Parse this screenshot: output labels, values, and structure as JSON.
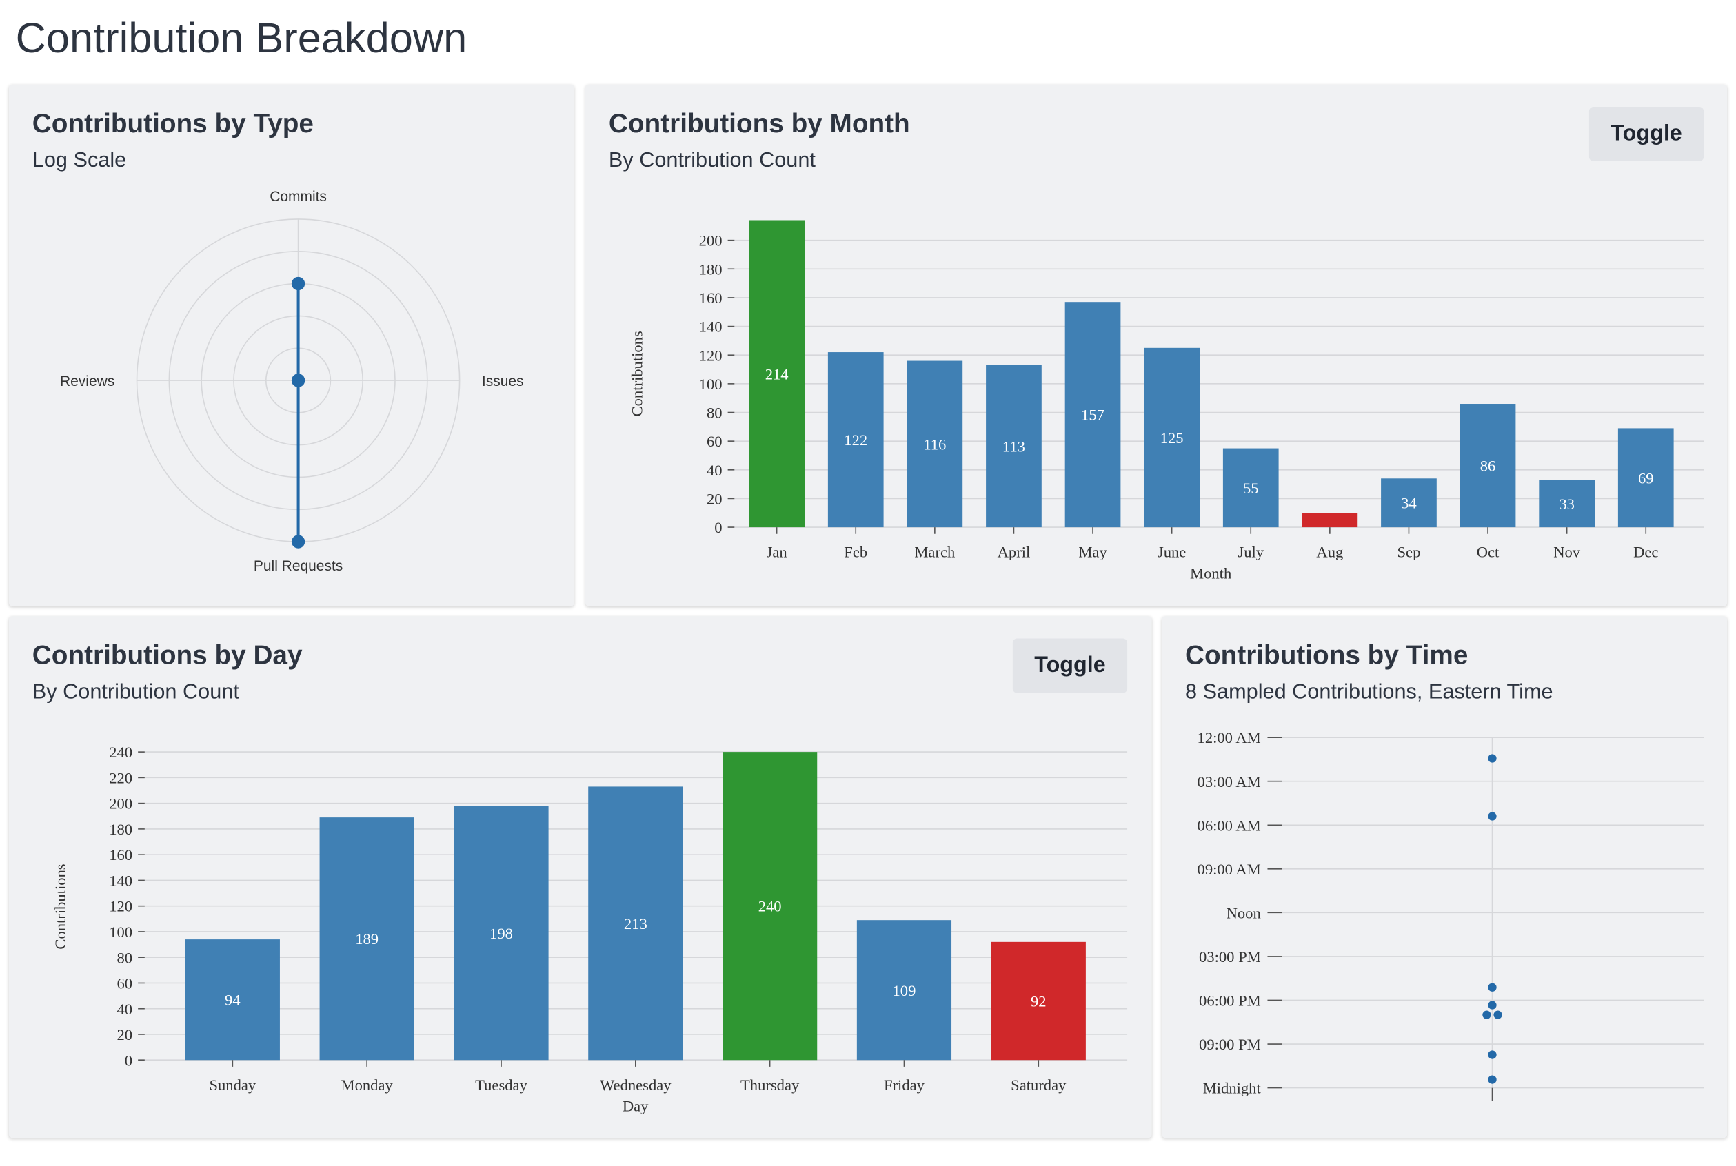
{
  "page": {
    "title": "Contribution Breakdown"
  },
  "colors": {
    "bar": "#4080b4",
    "max": "#2f9632",
    "min": "#d0282a",
    "point": "#2369a8",
    "grid": "#d6d7da",
    "panel": "#f0f1f3"
  },
  "panels": {
    "type": {
      "title": "Contributions by Type",
      "subtitle": "Log Scale"
    },
    "month": {
      "title": "Contributions by Month",
      "subtitle": "By Contribution Count",
      "toggle_label": "Toggle"
    },
    "day": {
      "title": "Contributions by Day",
      "subtitle": "By Contribution Count",
      "toggle_label": "Toggle"
    },
    "time": {
      "title": "Contributions by Time",
      "subtitle": "8 Sampled Contributions, Eastern Time"
    }
  },
  "chart_data": [
    {
      "type": "radar",
      "scale": "log",
      "axes": [
        "Commits",
        "Issues",
        "Pull Requests",
        "Reviews"
      ],
      "levels": 5,
      "values_in_levels": [
        3,
        0,
        5,
        0
      ],
      "grid": true
    },
    {
      "type": "bar",
      "categories": [
        "Jan",
        "Feb",
        "March",
        "April",
        "May",
        "June",
        "July",
        "Aug",
        "Sep",
        "Oct",
        "Nov",
        "Dec"
      ],
      "values": [
        214,
        122,
        116,
        113,
        157,
        125,
        55,
        10,
        34,
        86,
        33,
        69
      ],
      "data_labels": [
        "214",
        "122",
        "116",
        "113",
        "157",
        "125",
        "55",
        "",
        "34",
        "86",
        "33",
        "69"
      ],
      "xlabel": "Month",
      "ylabel": "Contributions",
      "ylim": [
        0,
        200
      ],
      "yticks": [
        0,
        20,
        40,
        60,
        80,
        100,
        120,
        140,
        160,
        180,
        200
      ],
      "grid": true,
      "highlight": {
        "max": "Jan",
        "min": "Aug"
      }
    },
    {
      "type": "bar",
      "categories": [
        "Sunday",
        "Monday",
        "Tuesday",
        "Wednesday",
        "Thursday",
        "Friday",
        "Saturday"
      ],
      "values": [
        94,
        189,
        198,
        213,
        240,
        109,
        92
      ],
      "xlabel": "Day",
      "ylabel": "Contributions",
      "ylim": [
        0,
        240
      ],
      "yticks": [
        0,
        20,
        40,
        60,
        80,
        100,
        120,
        140,
        160,
        180,
        200,
        220,
        240
      ],
      "grid": true,
      "highlight": {
        "max": "Thursday",
        "min": "Saturday"
      }
    },
    {
      "type": "scatter",
      "y_axis": "time of day",
      "ytick_labels": [
        "12:00 AM",
        "03:00 AM",
        "06:00 AM",
        "09:00 AM",
        "Noon",
        "03:00 PM",
        "06:00 PM",
        "09:00 PM",
        "Midnight"
      ],
      "points": [
        "01:26 AM",
        "05:24 AM",
        "05:07 PM",
        "06:20 PM",
        "07:00 PM",
        "07:00 PM",
        "09:44 PM",
        "11:26 PM"
      ],
      "grid": true
    }
  ]
}
